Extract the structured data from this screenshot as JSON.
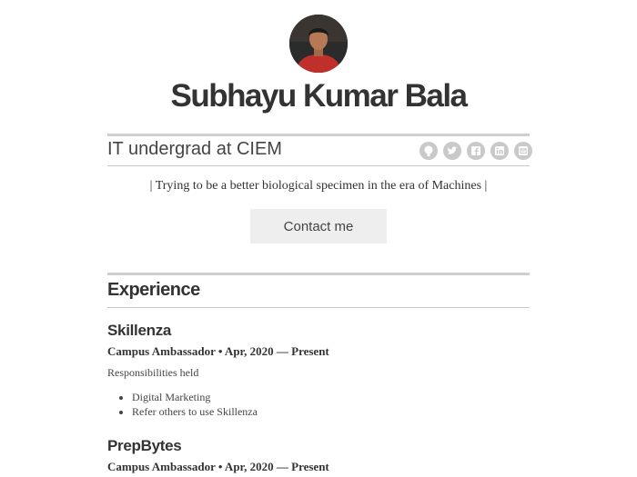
{
  "profile": {
    "name": "Subhayu Kumar Bala",
    "tagline": "IT undergrad at CIEM",
    "quote": "| Trying to be a better biological specimen in the era of Machines |",
    "contact_label": "Contact me"
  },
  "socials": [
    {
      "icon": "github-icon"
    },
    {
      "icon": "twitter-icon"
    },
    {
      "icon": "facebook-icon"
    },
    {
      "icon": "linkedin-icon"
    },
    {
      "icon": "email-icon"
    }
  ],
  "experience": {
    "title": "Experience",
    "items": [
      {
        "company": "Skillenza",
        "role": "Campus Ambassador • Apr, 2020 — Present",
        "desc": "Responsibilities held",
        "bullets": [
          "Digital Marketing",
          "Refer others to use Skillenza"
        ]
      },
      {
        "company": "PrepBytes",
        "role": "Campus Ambassador • Apr, 2020 — Present"
      }
    ]
  },
  "colors": {
    "text": "#333333",
    "rule": "#cfcfcf",
    "icon_bg": "#c9c9c9",
    "button_bg": "#eeeeee",
    "avatar_shirt": "#c0302a"
  }
}
